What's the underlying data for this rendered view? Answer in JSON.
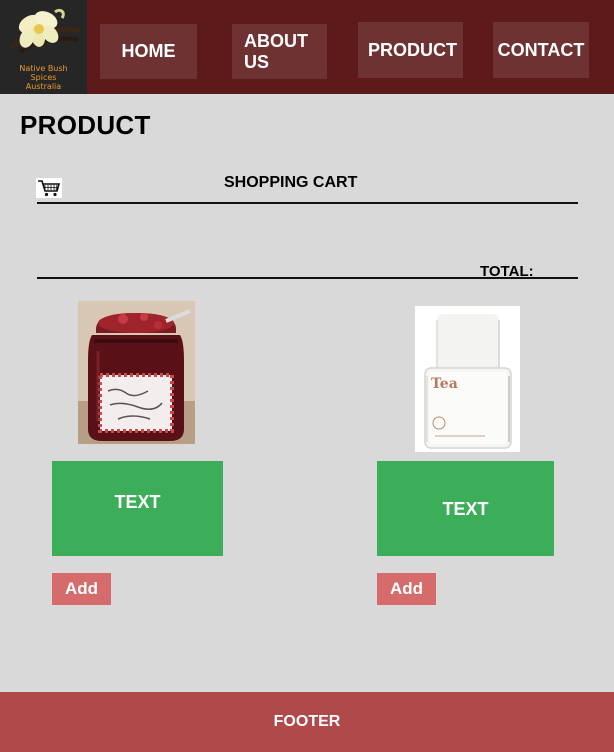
{
  "header": {
    "logo_text": "Native Bush\nSpices\nAustralia",
    "nav": {
      "home": "HOME",
      "about": "ABOUT\nUS",
      "product": "PRODUCT",
      "contact": "CONTACT"
    }
  },
  "page": {
    "title": "PRODUCT"
  },
  "cart": {
    "title": "SHOPPING CART",
    "total_label": "TOTAL:"
  },
  "products": [
    {
      "image_label": "Raspberry and Redcurrant Jam",
      "text": "TEXT",
      "add_label": "Add"
    },
    {
      "image_label": "Tea",
      "text": "TEXT",
      "add_label": "Add"
    }
  ],
  "footer": {
    "text": "FOOTER"
  },
  "colors": {
    "header_bg": "#5e1a1a",
    "nav_btn": "#6f3232",
    "page_bg": "#d9d9d9",
    "green": "#3cae5a",
    "add_btn": "#d66b6b",
    "footer_bg": "#b04a4a"
  }
}
